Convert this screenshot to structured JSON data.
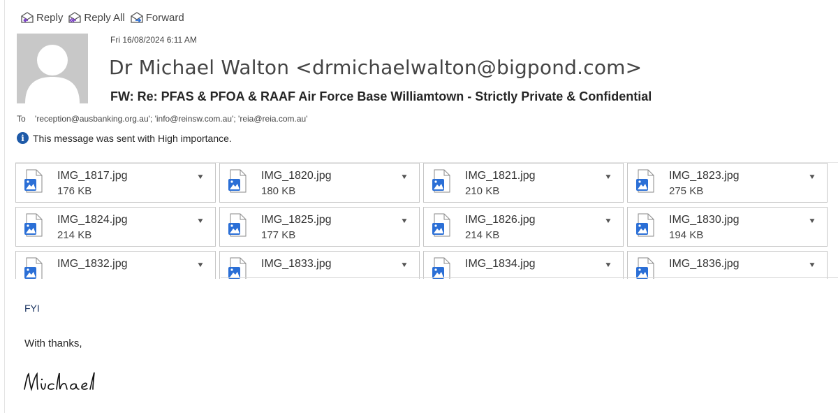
{
  "toolbar": {
    "reply": "Reply",
    "reply_all": "Reply All",
    "forward": "Forward"
  },
  "header": {
    "date": "Fri 16/08/2024 6:11 AM",
    "from": "Dr Michael Walton <drmichaelwalton@bigpond.com>",
    "subject": "FW: Re: PFAS & PFOA & RAAF Air Force Base Williamtown - Strictly Private & Confidential",
    "to_label": "To",
    "to_value": "'reception@ausbanking.org.au'; 'info@reinsw.com.au'; 'reia@reia.com.au'",
    "importance": "This message was sent with High importance."
  },
  "attachments": [
    {
      "name": "IMG_1817.jpg",
      "size": "176 KB"
    },
    {
      "name": "IMG_1820.jpg",
      "size": "180 KB"
    },
    {
      "name": "IMG_1821.jpg",
      "size": "210 KB"
    },
    {
      "name": "IMG_1823.jpg",
      "size": "275 KB"
    },
    {
      "name": "IMG_1824.jpg",
      "size": "214 KB"
    },
    {
      "name": "IMG_1825.jpg",
      "size": "177 KB"
    },
    {
      "name": "IMG_1826.jpg",
      "size": "214 KB"
    },
    {
      "name": "IMG_1830.jpg",
      "size": "194 KB"
    },
    {
      "name": "IMG_1832.jpg",
      "size": ""
    },
    {
      "name": "IMG_1833.jpg",
      "size": ""
    },
    {
      "name": "IMG_1834.jpg",
      "size": ""
    },
    {
      "name": "IMG_1836.jpg",
      "size": ""
    }
  ],
  "body": {
    "fyi": "FYI",
    "thanks": "With thanks,",
    "signature": "Michael"
  },
  "colors": {
    "link_blue": "#1f3864",
    "info_blue": "#1e5aa8",
    "icon_blue": "#2b6fd6"
  }
}
